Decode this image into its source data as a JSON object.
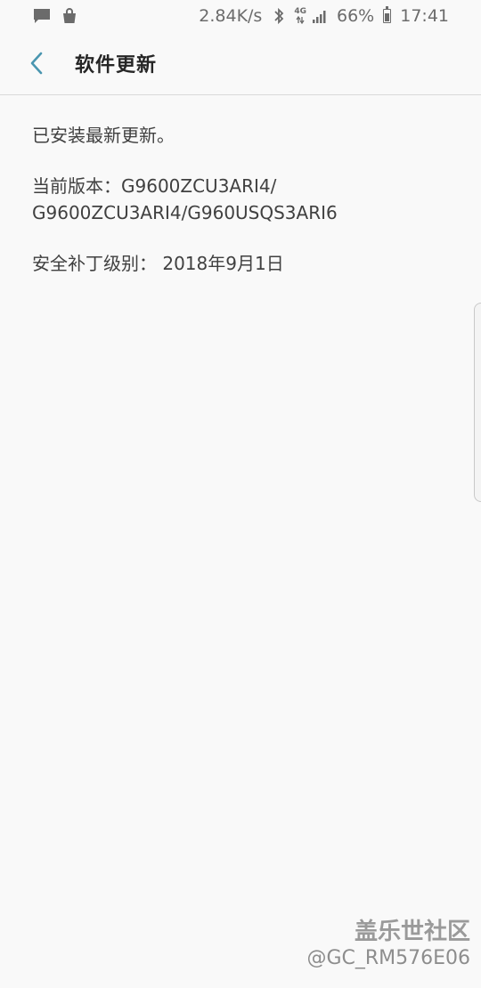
{
  "status_bar": {
    "network_speed": "2.84K/s",
    "network_type": "4G",
    "battery": "66%",
    "battery_level": 0.66,
    "time": "17:41",
    "icons": [
      "message-icon",
      "shopping-bag-icon",
      "bluetooth-icon",
      "data-arrows-icon",
      "signal-icon",
      "battery-icon"
    ]
  },
  "header": {
    "title": "软件更新",
    "back_icon": "chevron-left-icon",
    "accent_color": "#4a96b0"
  },
  "content": {
    "status_text": "已安装最新更新。",
    "version_line": "当前版本：G9600ZCU3ARI4/ G9600ZCU3ARI4/G960USQS3ARI6",
    "security_patch_line": "安全补丁级别： 2018年9月1日"
  },
  "watermark": {
    "line1": "盖乐世社区",
    "line2": "@GC_RM576E06"
  }
}
